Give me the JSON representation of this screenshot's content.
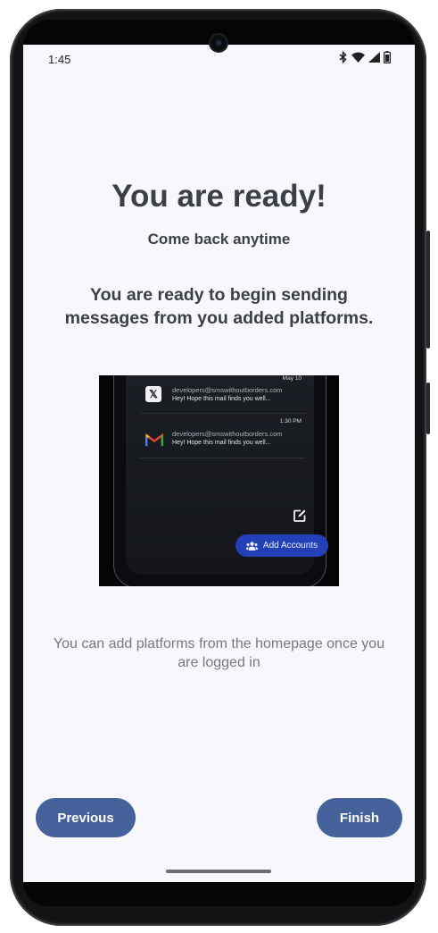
{
  "status_bar": {
    "time": "1:45",
    "icons": [
      "bluetooth-icon",
      "wifi-icon",
      "signal-icon",
      "battery-icon"
    ]
  },
  "onboarding": {
    "title": "You are ready!",
    "subtitle": "Come back anytime",
    "lead": "You are ready to begin sending messages from you added platforms.",
    "hint": "You can add platforms from the homepage once you are logged in"
  },
  "preview": {
    "rows": [
      {
        "date": "May 10",
        "icon": "x-logo-icon",
        "email": "developers@smswithoutborders.com",
        "message": "Hey! Hope this mail finds you well..."
      },
      {
        "date": "1:30 PM",
        "icon": "gmail-logo-icon",
        "email": "developers@smswithoutborders.com",
        "message": "Hey! Hope this mail finds you well..."
      }
    ],
    "add_accounts_label": "Add Accounts",
    "icons": [
      "edit-icon",
      "people-icon"
    ]
  },
  "navigation": {
    "previous_label": "Previous",
    "finish_label": "Finish"
  },
  "colors": {
    "screen_background": "#f8f7fc",
    "heading_text": "#3b3f47",
    "hint_text": "#747983",
    "button_background": "#45639a",
    "preview_add_button": "#2340b8"
  }
}
